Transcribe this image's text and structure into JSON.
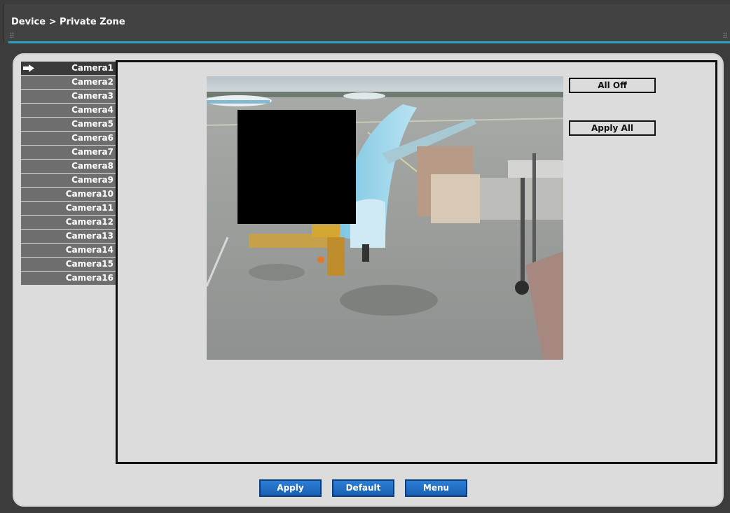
{
  "header": {
    "breadcrumb": "Device > Private Zone"
  },
  "cameras": {
    "items": [
      {
        "label": "Camera1"
      },
      {
        "label": "Camera2"
      },
      {
        "label": "Camera3"
      },
      {
        "label": "Camera4"
      },
      {
        "label": "Camera5"
      },
      {
        "label": "Camera6"
      },
      {
        "label": "Camera7"
      },
      {
        "label": "Camera8"
      },
      {
        "label": "Camera9"
      },
      {
        "label": "Camera10"
      },
      {
        "label": "Camera11"
      },
      {
        "label": "Camera12"
      },
      {
        "label": "Camera13"
      },
      {
        "label": "Camera14"
      },
      {
        "label": "Camera15"
      },
      {
        "label": "Camera16"
      }
    ],
    "selected": "Camera1"
  },
  "actions": {
    "all_off_label": "All Off",
    "apply_all_label": "Apply All"
  },
  "footer": {
    "apply_label": "Apply",
    "default_label": "Default",
    "menu_label": "Menu"
  },
  "colors": {
    "accent": "#2aa3c8",
    "button_blue": "#1f6cc4",
    "selected_item": "#3a3a3a",
    "item": "#6e6e6e"
  },
  "icons": {
    "selected_indicator": "arrow-right-icon"
  }
}
